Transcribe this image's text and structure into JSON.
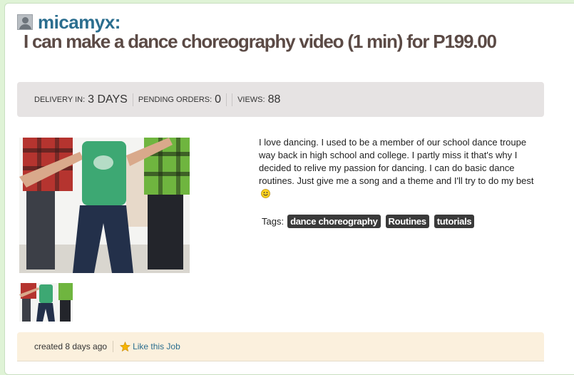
{
  "seller": {
    "username": "micamyx:"
  },
  "job": {
    "title": "I can make a dance choreography video (1 min) for P199.00"
  },
  "stats": [
    {
      "label": "DELIVERY IN:",
      "value": "3 DAYS"
    },
    {
      "label": "PENDING ORDERS:",
      "value": "0"
    },
    {
      "label": "VIEWS:",
      "value": "88"
    }
  ],
  "description": "I love dancing. I used to be a member of our school dance troupe way back in high school and college. I partly miss it that's why I decided to relive my passion for dancing. I can do basic dance routines. Just give me a song and a theme and I'll try to do my best",
  "tags": {
    "label": "Tags:",
    "items": [
      "dance choreography",
      "Routines",
      "tutorials"
    ]
  },
  "footer": {
    "created": "created 8 days ago",
    "like": "Like this Job"
  },
  "colors": {
    "page_bg": "#dff3d6",
    "username": "#2b6e8f",
    "title": "#5b4a45",
    "stats_bg": "#e6e3e3",
    "tag_bg": "#3a3a3a",
    "footer_bg": "#fbf0dd"
  },
  "icons": {
    "avatar": "user-avatar-icon",
    "smiley": "smiley-icon",
    "star": "star-icon"
  }
}
